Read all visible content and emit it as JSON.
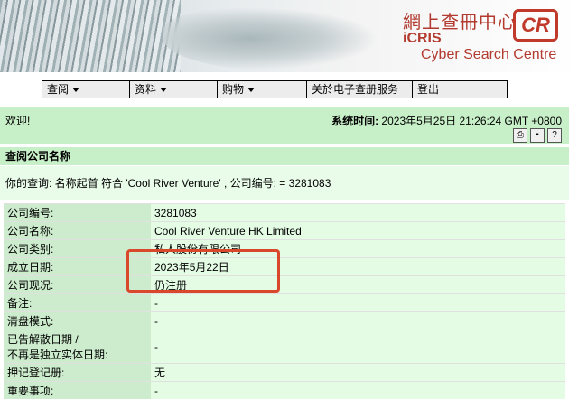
{
  "header": {
    "logo_cn": "網上查冊中心",
    "logo_icris": "iCRIS",
    "logo_sub": "Cyber Search Centre",
    "logo_badge": "CR"
  },
  "nav": [
    {
      "label": "查阅",
      "has_dropdown": true
    },
    {
      "label": "资料",
      "has_dropdown": true
    },
    {
      "label": "购物",
      "has_dropdown": true
    },
    {
      "label": "关於电子查册服务",
      "has_dropdown": false
    },
    {
      "label": "登出",
      "has_dropdown": false
    }
  ],
  "welcome": {
    "greeting": "欢迎!",
    "systime_label": "系统时间:",
    "systime_value": "2023年5月25日 21:26:24 GMT +0800"
  },
  "tools": [
    "print-icon",
    "save-icon",
    "help-icon"
  ],
  "section": {
    "title": "查阅公司名称",
    "query": "你的查询:  名称起首 符合 'Cool River Venture' , 公司编号:  = 3281083"
  },
  "rows": [
    {
      "label": "公司编号:",
      "value": "3281083"
    },
    {
      "label": "公司名称:",
      "value": "Cool River Venture HK Limited"
    },
    {
      "label": "公司类别:",
      "value": "私人股份有限公司"
    },
    {
      "label": "成立日期:",
      "value": "2023年5月22日"
    },
    {
      "label": "公司现况:",
      "value": "仍注册"
    },
    {
      "label": "备注:",
      "value": "-"
    },
    {
      "label": "清盘模式:",
      "value": "-"
    },
    {
      "label": "已告解散日期 /\n不再是独立实体日期:",
      "value": "-"
    },
    {
      "label": "押记登记册:",
      "value": "无"
    },
    {
      "label": "重要事项:",
      "value": "-"
    }
  ],
  "colors": {
    "panel_green": "#c8f0c8",
    "highlight_red": "#d9482a",
    "logo_red": "#b23a2f"
  }
}
